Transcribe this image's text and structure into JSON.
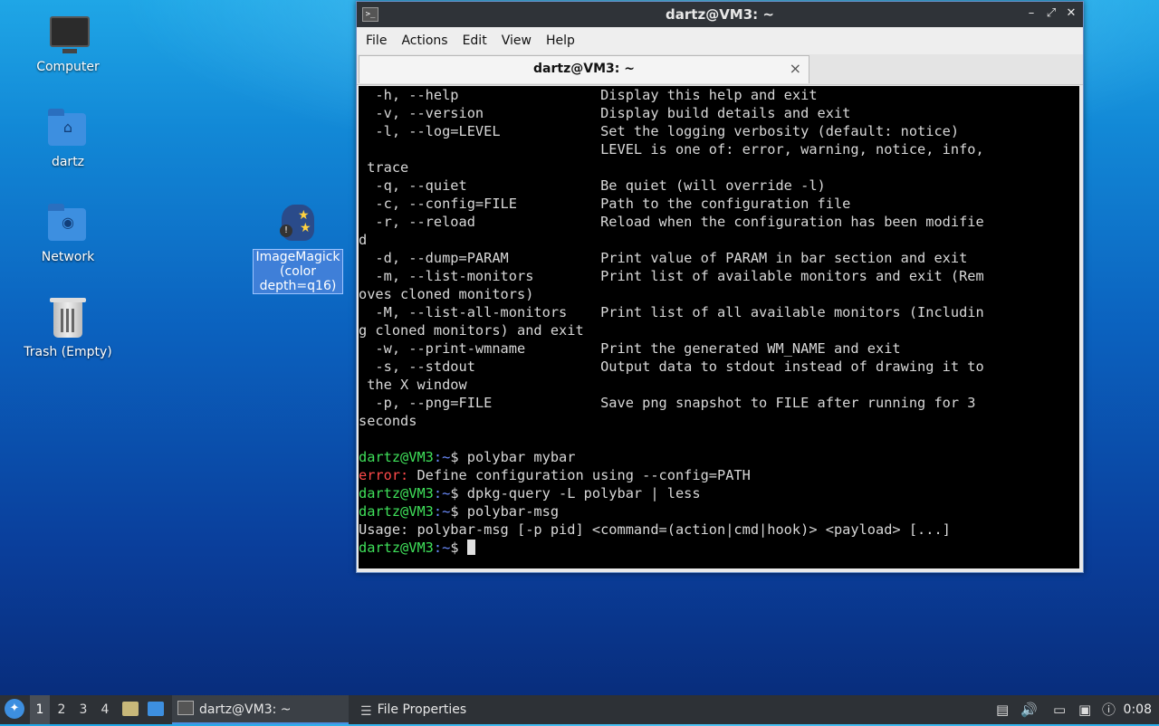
{
  "desktop": {
    "icons": [
      {
        "label": "Computer"
      },
      {
        "label": "dartz"
      },
      {
        "label": "Network"
      },
      {
        "label": "Trash (Empty)"
      },
      {
        "label": "ImageMagick (color depth=q16)"
      }
    ]
  },
  "window": {
    "title": "dartz@VM3: ~",
    "menu": [
      "File",
      "Actions",
      "Edit",
      "View",
      "Help"
    ],
    "tab_title": "dartz@VM3: ~",
    "terminal_lines": [
      "  -h, --help                 Display this help and exit",
      "  -v, --version              Display build details and exit",
      "  -l, --log=LEVEL            Set the logging verbosity (default: notice)",
      "                             LEVEL is one of: error, warning, notice, info,",
      " trace",
      "  -q, --quiet                Be quiet (will override -l)",
      "  -c, --config=FILE          Path to the configuration file",
      "  -r, --reload               Reload when the configuration has been modifie",
      "d",
      "  -d, --dump=PARAM           Print value of PARAM in bar section and exit",
      "  -m, --list-monitors        Print list of available monitors and exit (Rem",
      "oves cloned monitors)",
      "  -M, --list-all-monitors    Print list of all available monitors (Includin",
      "g cloned monitors) and exit",
      "  -w, --print-wmname         Print the generated WM_NAME and exit",
      "  -s, --stdout               Output data to stdout instead of drawing it to",
      " the X window",
      "  -p, --png=FILE             Save png snapshot to FILE after running for 3",
      "seconds",
      ""
    ],
    "prompt_user": "dartz@VM3",
    "prompt_path": ":~",
    "prompt_sym": "$ ",
    "cmd1": "polybar mybar",
    "error_label": "error:",
    "error_msg": " Define configuration using --config=PATH",
    "cmd2": "dpkg-query -L polybar | less",
    "cmd3": "polybar-msg",
    "usage_line": "Usage: polybar-msg [-p pid] <command=(action|cmd|hook)> <payload> [...]"
  },
  "taskbar": {
    "workspaces": [
      "1",
      "2",
      "3",
      "4"
    ],
    "tasks": [
      {
        "label": "dartz@VM3: ~"
      },
      {
        "label": "File Properties"
      }
    ],
    "clock": "0:08"
  },
  "colors": {
    "prompt_green": "#3fe05a",
    "prompt_blue": "#6b8cff",
    "error_red": "#ff4a4a"
  }
}
